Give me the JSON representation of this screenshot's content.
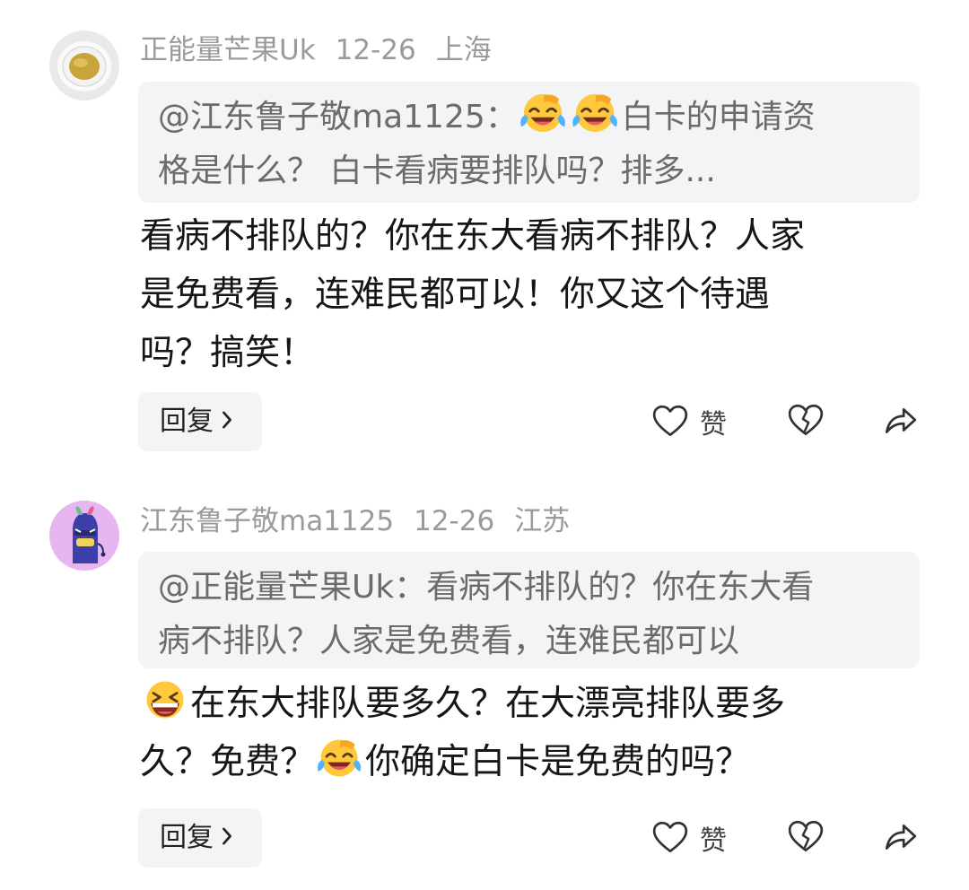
{
  "comments": [
    {
      "username": "正能量芒果Uk",
      "date": "12-26",
      "location": "上海",
      "avatar_icon": "tea-cup-avatar",
      "quote_prefix": "@江东鲁子敬ma1125：",
      "quote_emojis": [
        "crying-laughing-emoji",
        "crying-laughing-emoji"
      ],
      "quote_after_emoji": "白卡的申请资",
      "quote_line2": "格是什么？ 白卡看病要排队吗？排多...",
      "text_line1": "看病不排队的？你在东大看病不排队？人家",
      "text_line2": "是免费看，连难民都可以！你又这个待遇",
      "text_line3": "吗？搞笑！",
      "reply_label": "回复",
      "like_label": "赞"
    },
    {
      "username": "江东鲁子敬ma1125",
      "date": "12-26",
      "location": "江苏",
      "avatar_icon": "purple-cartoon-avatar",
      "quote_line1": "@正能量芒果Uk：看病不排队的？你在东大看",
      "quote_line2": "病不排队？人家是免费看，连难民都可以",
      "text_line1_emoji": "grinning-squint-emoji",
      "text_line1": "在东大排队要多久？在大漂亮排队要多",
      "text_line2_a": "久？免费？",
      "text_line2_emoji": "crying-laughing-emoji",
      "text_line2_b": "你确定白卡是免费的吗？",
      "reply_label": "回复",
      "like_label": "赞"
    }
  ],
  "colors": {
    "meta_text": "#9a9a9a",
    "quote_bg": "#f4f4f6",
    "quote_text": "#6b6b6b",
    "body_text": "#161616"
  }
}
